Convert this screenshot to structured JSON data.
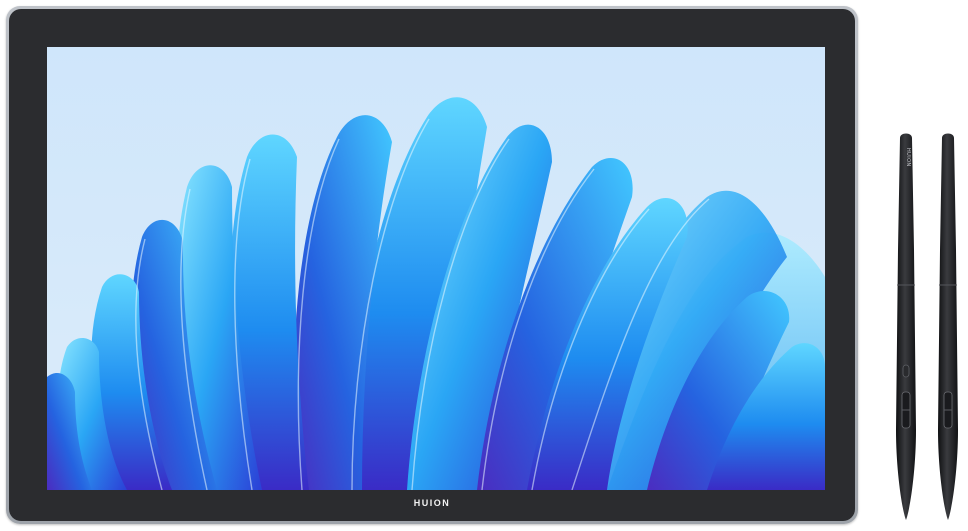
{
  "product": {
    "brand_label": "HUION",
    "pen_label": "HUION",
    "wallpaper_icon": "abstract-blue-petals-icon",
    "colors": {
      "bezel": "#2b2c2f",
      "frame": "#a9adb3",
      "pen_body": "#1e1f22",
      "sky": "#cfe6fb",
      "petal_light": "#3fc6ff",
      "petal_mid": "#1f7fe8",
      "petal_deep": "#3b2fc9"
    }
  }
}
